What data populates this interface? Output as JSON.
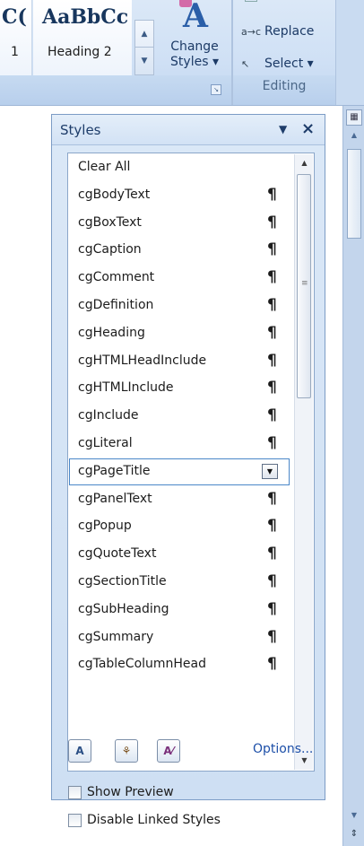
{
  "ribbon": {
    "gallery": [
      {
        "sample": "AaBbCc",
        "label": "1",
        "visible_sample": "C("
      },
      {
        "sample": "AaBbCc",
        "label": "Heading 2"
      }
    ],
    "change_styles": {
      "line1": "Change",
      "line2": "Styles ▾"
    },
    "editing": {
      "replace_label": "Replace",
      "select_label": "Select ▾",
      "group_title": "Editing"
    }
  },
  "styles_pane": {
    "title": "Styles",
    "items": [
      {
        "name": "Clear All",
        "para": ""
      },
      {
        "name": "cgBodyText",
        "para": "¶"
      },
      {
        "name": "cgBoxText",
        "para": "¶"
      },
      {
        "name": "cgCaption",
        "para": "¶"
      },
      {
        "name": "cgComment",
        "para": "¶"
      },
      {
        "name": "cgDefinition",
        "para": "¶"
      },
      {
        "name": "cgHeading",
        "para": "¶"
      },
      {
        "name": "cgHTMLHeadInclude",
        "para": "¶"
      },
      {
        "name": "cgHTMLInclude",
        "para": "¶"
      },
      {
        "name": "cgInclude",
        "para": "¶"
      },
      {
        "name": "cgLiteral",
        "para": "¶"
      },
      {
        "name": "cgPageTitle",
        "para": "",
        "selected": true
      },
      {
        "name": "cgPanelText",
        "para": "¶"
      },
      {
        "name": "cgPopup",
        "para": "¶"
      },
      {
        "name": "cgQuoteText",
        "para": "¶"
      },
      {
        "name": "cgSectionTitle",
        "para": "¶"
      },
      {
        "name": "cgSubHeading",
        "para": "¶"
      },
      {
        "name": "cgSummary",
        "para": "¶"
      },
      {
        "name": "cgTableColumnHead",
        "para": "¶"
      }
    ],
    "show_preview_label": "Show Preview",
    "disable_linked_label": "Disable Linked Styles",
    "options_label": "Options...",
    "icons": {
      "new_style": "new-style-icon",
      "style_inspector": "style-inspector-icon",
      "manage_styles": "manage-styles-icon"
    }
  },
  "colors": {
    "pane_bg": "#cfe0f4",
    "link": "#1d4fa8",
    "selection_border": "#4a87c8"
  }
}
